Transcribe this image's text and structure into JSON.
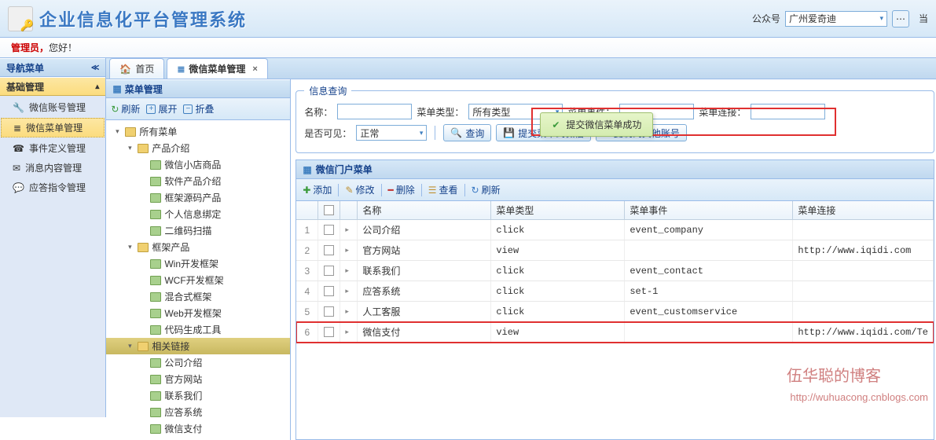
{
  "header": {
    "title": "企业信息化平台管理系统",
    "account_label": "公众号",
    "account_value": "广州爱奇迪",
    "right_text": "当"
  },
  "welcome": {
    "admin": "管理员，",
    "hello": "您好！"
  },
  "nav": {
    "title": "导航菜单",
    "group": "基础管理",
    "items": [
      {
        "icon": "🔧",
        "label": "微信账号管理"
      },
      {
        "icon": "≣",
        "label": "微信菜单管理",
        "selected": true
      },
      {
        "icon": "☎",
        "label": "事件定义管理"
      },
      {
        "icon": "✉",
        "label": "消息内容管理"
      },
      {
        "icon": "💬",
        "label": "应答指令管理"
      }
    ]
  },
  "tabs": {
    "home": "首页",
    "active": "微信菜单管理"
  },
  "tree": {
    "title": "菜单管理",
    "toolbar": {
      "refresh": "刷新",
      "expand": "展开",
      "collapse": "折叠"
    },
    "root": "所有菜单",
    "groups": [
      {
        "label": "产品介绍",
        "children": [
          "微信小店商品",
          "软件产品介绍",
          "框架源码产品",
          "个人信息绑定",
          "二维码扫描"
        ]
      },
      {
        "label": "框架产品",
        "children": [
          "Win开发框架",
          "WCF开发框架",
          "混合式框架",
          "Web开发框架",
          "代码生成工具"
        ]
      },
      {
        "label": "相关链接",
        "selected": true,
        "children": [
          "公司介绍",
          "官方网站",
          "联系我们",
          "应答系统",
          "微信支付"
        ]
      }
    ]
  },
  "query": {
    "legend": "信息查询",
    "name_label": "名称：",
    "type_label": "菜单类型：",
    "type_value": "所有类型",
    "event_label": "菜单事件：",
    "link_label": "菜单连接：",
    "visible_label": "是否可见：",
    "visible_value": "正常",
    "search_btn": "查询",
    "submit_btn": "提交菜单到微信",
    "copy_btn": "复制到其他账号"
  },
  "toast": {
    "text": "提交微信菜单成功"
  },
  "grid": {
    "title": "微信门户菜单",
    "toolbar": {
      "add": "添加",
      "edit": "修改",
      "delete": "删除",
      "view": "查看",
      "refresh": "刷新"
    },
    "columns": {
      "name": "名称",
      "type": "菜单类型",
      "event": "菜单事件",
      "link": "菜单连接"
    },
    "rows": [
      {
        "n": "1",
        "name": "公司介绍",
        "type": "click",
        "event": "event_company",
        "link": ""
      },
      {
        "n": "2",
        "name": "官方网站",
        "type": "view",
        "event": "",
        "link": "http://www.iqidi.com"
      },
      {
        "n": "3",
        "name": "联系我们",
        "type": "click",
        "event": "event_contact",
        "link": ""
      },
      {
        "n": "4",
        "name": "应答系统",
        "type": "click",
        "event": "set-1",
        "link": ""
      },
      {
        "n": "5",
        "name": "人工客服",
        "type": "click",
        "event": "event_customservice",
        "link": ""
      },
      {
        "n": "6",
        "name": "微信支付",
        "type": "view",
        "event": "",
        "link": "http://www.iqidi.com/Te",
        "highlight": true
      }
    ]
  },
  "watermark": {
    "title": "伍华聪的博客",
    "url": "http://wuhuacong.cnblogs.com"
  }
}
